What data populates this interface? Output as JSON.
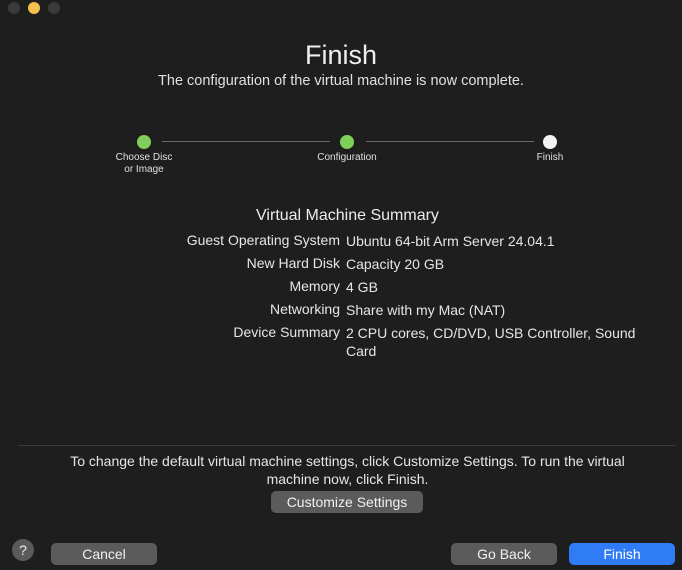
{
  "window": {
    "title": "Finish",
    "subtitle": "The configuration of the virtual machine is now complete."
  },
  "steps": [
    {
      "label": "Choose Disc\nor Image",
      "state": "done"
    },
    {
      "label": "Configuration",
      "state": "done"
    },
    {
      "label": "Finish",
      "state": "current"
    }
  ],
  "summary": {
    "title": "Virtual Machine Summary",
    "rows": [
      {
        "key": "Guest Operating System",
        "value": "Ubuntu 64-bit Arm Server 24.04.1"
      },
      {
        "key": "New Hard Disk",
        "value": "Capacity 20 GB"
      },
      {
        "key": "Memory",
        "value": "4 GB"
      },
      {
        "key": "Networking",
        "value": "Share with my Mac (NAT)"
      },
      {
        "key": "Device Summary",
        "value": "2 CPU cores, CD/DVD, USB Controller, Sound Card"
      }
    ]
  },
  "info_text": "To change the default virtual machine settings, click Customize Settings. To run the virtual machine now, click Finish.",
  "buttons": {
    "customize": "Customize Settings",
    "help": "?",
    "cancel": "Cancel",
    "go_back": "Go Back",
    "finish": "Finish"
  },
  "colors": {
    "accent": "#2f7cf6",
    "step_done": "#7ed05b",
    "step_current": "#f2f2f2",
    "minimize_light": "#f6c04f"
  },
  "icons": {
    "close": "close-light-icon",
    "minimize": "minimize-light-icon",
    "maximize": "maximize-light-icon",
    "help": "question-mark-icon"
  }
}
